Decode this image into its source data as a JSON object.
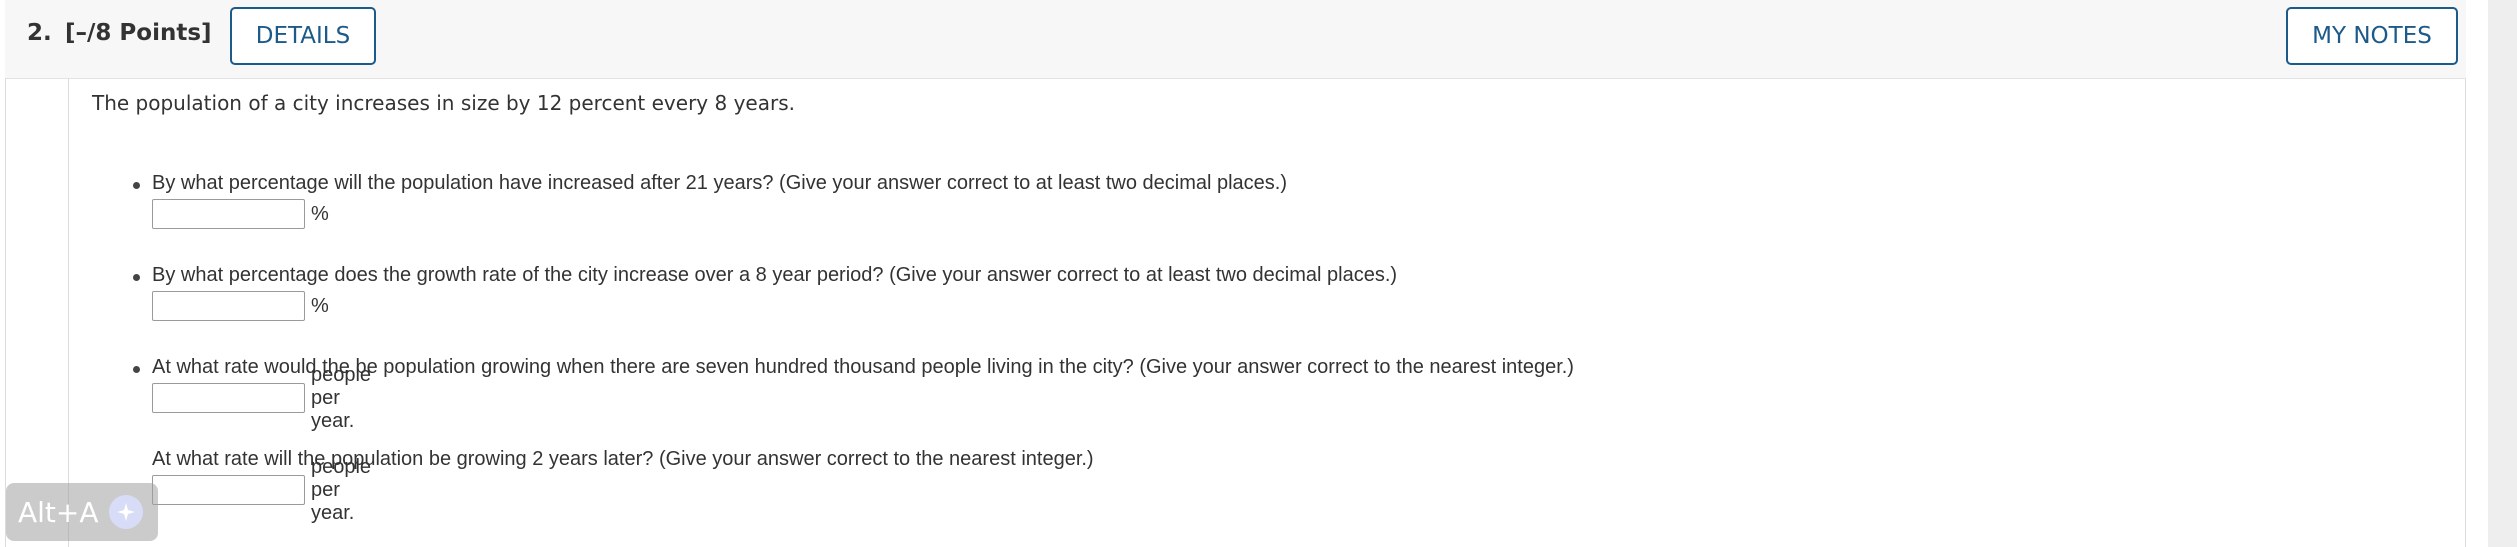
{
  "question": {
    "number": "2.",
    "points": "[–/8 Points]",
    "details_label": "DETAILS",
    "notes_label": "MY NOTES",
    "intro": "The population of a city increases in size by 12 percent every 8 years."
  },
  "parts": [
    {
      "prompt": "By what percentage will the population have increased after 21 years? (Give your answer correct to at least two decimal places.)",
      "value": "",
      "unit": "%"
    },
    {
      "prompt": "By what percentage does the growth rate of the city increase over a 8 year period? (Give your answer correct to at least two decimal places.)",
      "value": "",
      "unit": "%"
    },
    {
      "prompt": "At what rate would the be population growing when there are seven hundred thousand people living in the city? (Give your answer correct to the nearest integer.)",
      "value": "",
      "unit": "people per year."
    },
    {
      "prompt": "At what rate will the population be growing 2 years later? (Give your answer correct to the nearest integer.)",
      "value": "",
      "unit": "people per year."
    }
  ],
  "overlay": {
    "shortcut": "Alt+A",
    "icon": "sparkle-icon"
  },
  "colors": {
    "accent": "#1c5a8a",
    "header_bg": "#f7f7f7",
    "badge_icon": "#d8dcf6"
  }
}
